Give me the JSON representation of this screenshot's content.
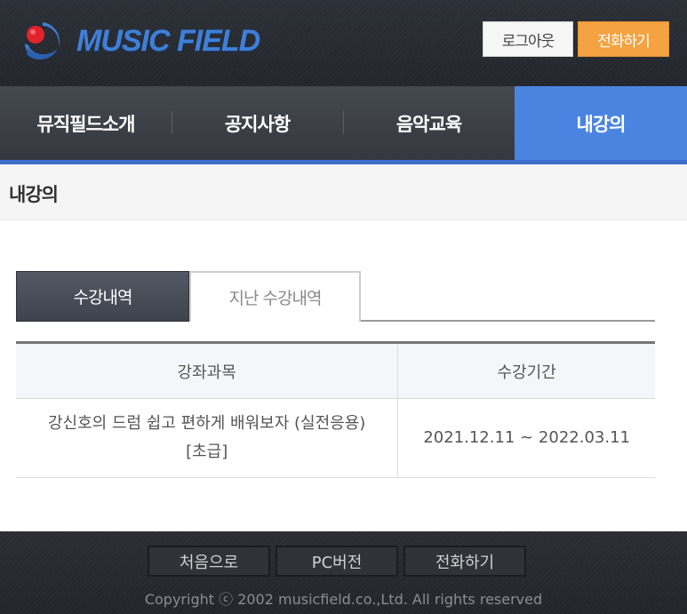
{
  "header": {
    "logo_text": "MUSIC FIELD",
    "logout_label": "로그아웃",
    "call_label": "전화하기"
  },
  "nav": {
    "items": [
      {
        "label": "뮤직필드소개"
      },
      {
        "label": "공지사항"
      },
      {
        "label": "음악교육"
      },
      {
        "label": "내강의"
      }
    ],
    "active_index": 3
  },
  "page": {
    "title": "내강의"
  },
  "tabs": [
    {
      "label": "수강내역",
      "selected": true
    },
    {
      "label": "지난 수강내역",
      "selected": false
    }
  ],
  "table": {
    "headers": [
      "강좌과목",
      "수강기간"
    ],
    "rows": [
      {
        "course_line1": "강신호의 드럼 쉽고 편하게 배워보자 (실전응용)",
        "course_line2": "[초급]",
        "period": "2021.12.11 ~ 2022.03.11"
      }
    ]
  },
  "footer": {
    "buttons": [
      "처음으로",
      "PC버전",
      "전화하기"
    ],
    "copyright": "Copyright ⓒ 2002 musicfield.co.,Ltd. All rights reserved"
  },
  "colors": {
    "accent_blue": "#4a84e0",
    "call_orange": "#f4a242",
    "logo_blue": "#3f7fd8",
    "logo_red": "#e0242c"
  }
}
